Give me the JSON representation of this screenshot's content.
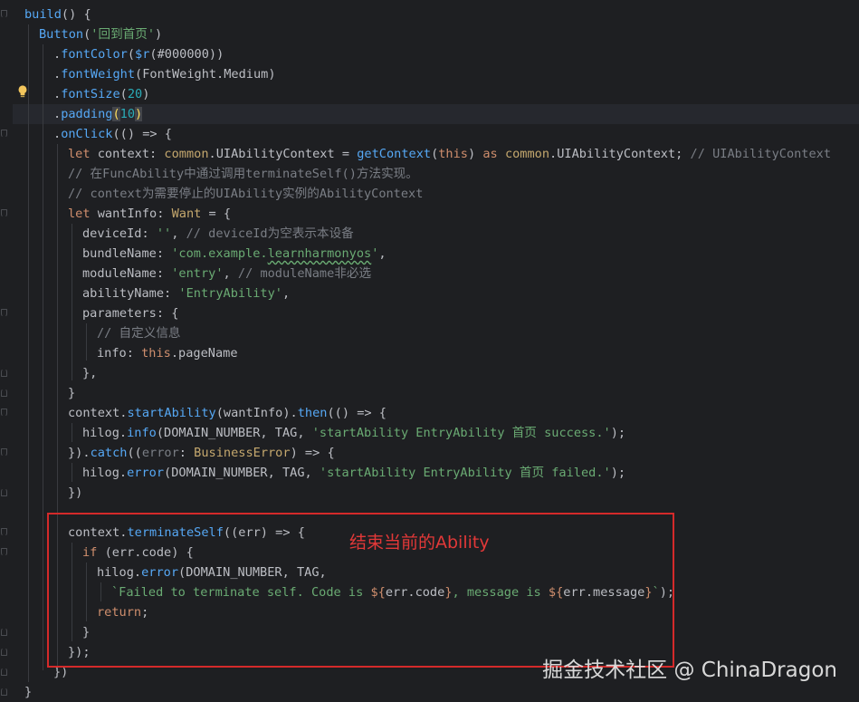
{
  "editor": {
    "lines": [
      [
        [
          "fn",
          "build"
        ],
        [
          "ident",
          "() {"
        ]
      ],
      [
        [
          "fn",
          "Button"
        ],
        [
          "ident",
          "("
        ],
        [
          "str",
          "'回到首页'"
        ],
        [
          "ident",
          ")"
        ]
      ],
      [
        [
          "ident",
          "."
        ],
        [
          "fn",
          "fontColor"
        ],
        [
          "ident",
          "("
        ],
        [
          "fn",
          "$r"
        ],
        [
          "ident",
          "(#000000))"
        ]
      ],
      [
        [
          "ident",
          "."
        ],
        [
          "fn",
          "fontWeight"
        ],
        [
          "ident",
          "(FontWeight.Medium)"
        ]
      ],
      [
        [
          "ident",
          "."
        ],
        [
          "fn",
          "fontSize"
        ],
        [
          "ident",
          "("
        ],
        [
          "num",
          "20"
        ],
        [
          "ident",
          ")"
        ]
      ],
      [
        [
          "ident",
          "."
        ],
        [
          "fn",
          "padding"
        ],
        [
          "match",
          "("
        ],
        [
          "num",
          "10"
        ],
        [
          "match",
          ")"
        ]
      ],
      [
        [
          "ident",
          "."
        ],
        [
          "fn",
          "onClick"
        ],
        [
          "ident",
          "(() => {"
        ]
      ],
      [
        [
          "kw",
          "let "
        ],
        [
          "ident",
          "context: "
        ],
        [
          "ty",
          "common"
        ],
        [
          "ident",
          "."
        ],
        [
          "ident",
          "UIAbilityContext = "
        ],
        [
          "fn",
          "getContext"
        ],
        [
          "ident",
          "("
        ],
        [
          "kw",
          "this"
        ],
        [
          "ident",
          ") "
        ],
        [
          "kw",
          "as "
        ],
        [
          "ty",
          "common"
        ],
        [
          "ident",
          ".UIAbilityContext; "
        ],
        [
          "cm",
          "// UIAbilityContext"
        ]
      ],
      [
        [
          "cm",
          "// 在FuncAbility中通过调用terminateSelf()方法实现。"
        ]
      ],
      [
        [
          "cm",
          "// context为需要停止的UIAbility实例的AbilityContext"
        ]
      ],
      [
        [
          "kw",
          "let "
        ],
        [
          "ident",
          "wantInfo: "
        ],
        [
          "ty",
          "Want"
        ],
        [
          "ident",
          " = {"
        ]
      ],
      [
        [
          "ident",
          "deviceId: "
        ],
        [
          "str",
          "''"
        ],
        [
          "ident",
          ", "
        ],
        [
          "cm",
          "// deviceId为空表示本设备"
        ]
      ],
      [
        [
          "ident",
          "bundleName: "
        ],
        [
          "str",
          "'com.example."
        ],
        [
          "sq",
          "learnharmonyos"
        ],
        [
          "str",
          "'"
        ],
        [
          "ident",
          ","
        ]
      ],
      [
        [
          "ident",
          "moduleName: "
        ],
        [
          "str",
          "'entry'"
        ],
        [
          "ident",
          ", "
        ],
        [
          "cm",
          "// moduleName非必选"
        ]
      ],
      [
        [
          "ident",
          "abilityName: "
        ],
        [
          "str",
          "'EntryAbility'"
        ],
        [
          "ident",
          ","
        ]
      ],
      [
        [
          "ident",
          "parameters: {"
        ]
      ],
      [
        [
          "cm",
          "// 自定义信息"
        ]
      ],
      [
        [
          "ident",
          "info: "
        ],
        [
          "kw",
          "this"
        ],
        [
          "ident",
          ".pageName"
        ]
      ],
      [
        [
          "ident",
          "},"
        ]
      ],
      [
        [
          "ident",
          "}"
        ]
      ],
      [
        [
          "ident",
          "context."
        ],
        [
          "fn",
          "startAbility"
        ],
        [
          "ident",
          "(wantInfo)."
        ],
        [
          "fn",
          "then"
        ],
        [
          "ident",
          "(() => {"
        ]
      ],
      [
        [
          "ident",
          "hilog."
        ],
        [
          "fn",
          "info"
        ],
        [
          "ident",
          "(DOMAIN_NUMBER, TAG, "
        ],
        [
          "str",
          "'startAbility EntryAbility 首页 success.'"
        ],
        [
          "ident",
          ");"
        ]
      ],
      [
        [
          "ident",
          "})."
        ],
        [
          "fn",
          "catch"
        ],
        [
          "ident",
          "(("
        ],
        [
          "cm",
          "error"
        ],
        [
          "ident",
          ": "
        ],
        [
          "ty",
          "BusinessError"
        ],
        [
          "ident",
          ") => {"
        ]
      ],
      [
        [
          "ident",
          "hilog."
        ],
        [
          "fn",
          "error"
        ],
        [
          "ident",
          "(DOMAIN_NUMBER, TAG, "
        ],
        [
          "str",
          "'startAbility EntryAbility 首页 failed.'"
        ],
        [
          "ident",
          ");"
        ]
      ],
      [
        [
          "ident",
          "})"
        ]
      ],
      [
        [
          "ident",
          ""
        ]
      ],
      [
        [
          "ident",
          "context."
        ],
        [
          "fn",
          "terminateSelf"
        ],
        [
          "ident",
          "((err) => {"
        ]
      ],
      [
        [
          "kw",
          "if "
        ],
        [
          "ident",
          "(err.code) {"
        ]
      ],
      [
        [
          "ident",
          "hilog."
        ],
        [
          "fn",
          "error"
        ],
        [
          "ident",
          "(DOMAIN_NUMBER, TAG,"
        ]
      ],
      [
        [
          "str",
          "`Failed to terminate self. Code is "
        ],
        [
          "kw",
          "${"
        ],
        [
          "ident",
          "err.code"
        ],
        [
          "kw",
          "}"
        ],
        [
          "str",
          ", message is "
        ],
        [
          "kw",
          "${"
        ],
        [
          "ident",
          "err.message"
        ],
        [
          "kw",
          "}"
        ],
        [
          "str",
          "`"
        ],
        [
          "ident",
          ");"
        ]
      ],
      [
        [
          "kw",
          "return"
        ],
        [
          "ident",
          ";"
        ]
      ],
      [
        [
          "ident",
          "}"
        ]
      ],
      [
        [
          "ident",
          "});"
        ]
      ],
      [
        [
          "ident",
          "})"
        ]
      ],
      [
        [
          "ident",
          "}"
        ]
      ]
    ]
  },
  "annotation": {
    "text": "结束当前的Ability"
  },
  "watermark": {
    "text": "掘金技术社区 @ ChinaDragon"
  },
  "icons": {
    "intention": "lightbulb-icon"
  },
  "colors": {
    "annotation_box": "#d42a2a",
    "background": "#1e1f22"
  }
}
